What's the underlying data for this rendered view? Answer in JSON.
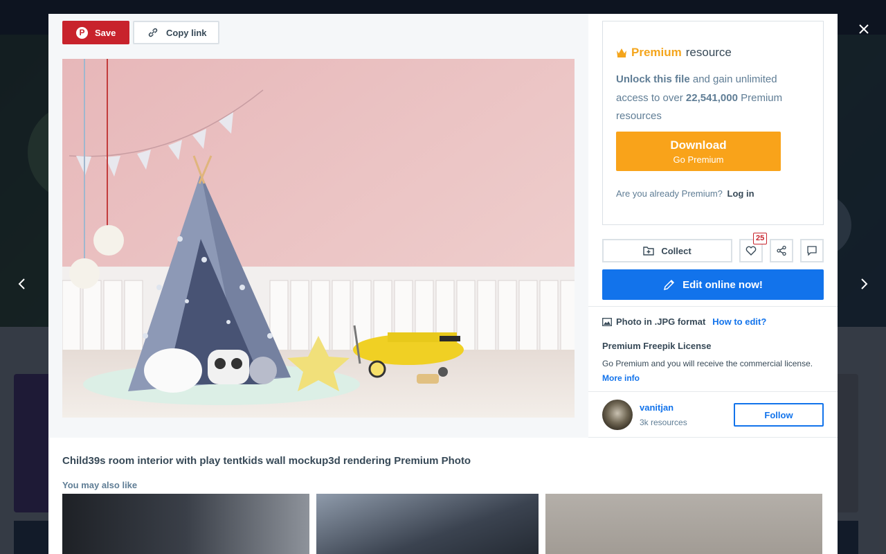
{
  "modal": {
    "save_label": "Save",
    "copy_link_label": "Copy link",
    "photo_alt": "Child's room interior with play tent",
    "photo_title": "Child39s room interior with play tentkids wall mockup3d rendering Premium Photo",
    "similar_title": "You may also like"
  },
  "premium": {
    "title_highlight": "Premium",
    "title_rest": "resource",
    "unlock_bold": "Unlock this file",
    "unlock_rest": "and gain unlimited access to over",
    "count_bold": "22,541,000",
    "count_rest": "Premium resources",
    "download_label": "Download",
    "download_sub": "Go Premium",
    "already_text": "Are you already Premium?",
    "login_label": "Log in",
    "accent_color": "#f9a31a"
  },
  "actions": {
    "collect_label": "Collect",
    "likes_count": "25",
    "edit_label": "Edit online now!"
  },
  "file_info": {
    "format_text": "Photo in .JPG format",
    "how_to_edit": "How to edit?",
    "license_title": "Premium Freepik License",
    "license_desc": "Go Premium and you will receive the commercial license.",
    "more_info": "More info"
  },
  "author": {
    "name": "vanitjan",
    "resources": "3k resources",
    "follow_label": "Follow"
  },
  "icons": {
    "close": "close-icon",
    "prev": "chevron-left-icon",
    "next": "chevron-right-icon"
  }
}
